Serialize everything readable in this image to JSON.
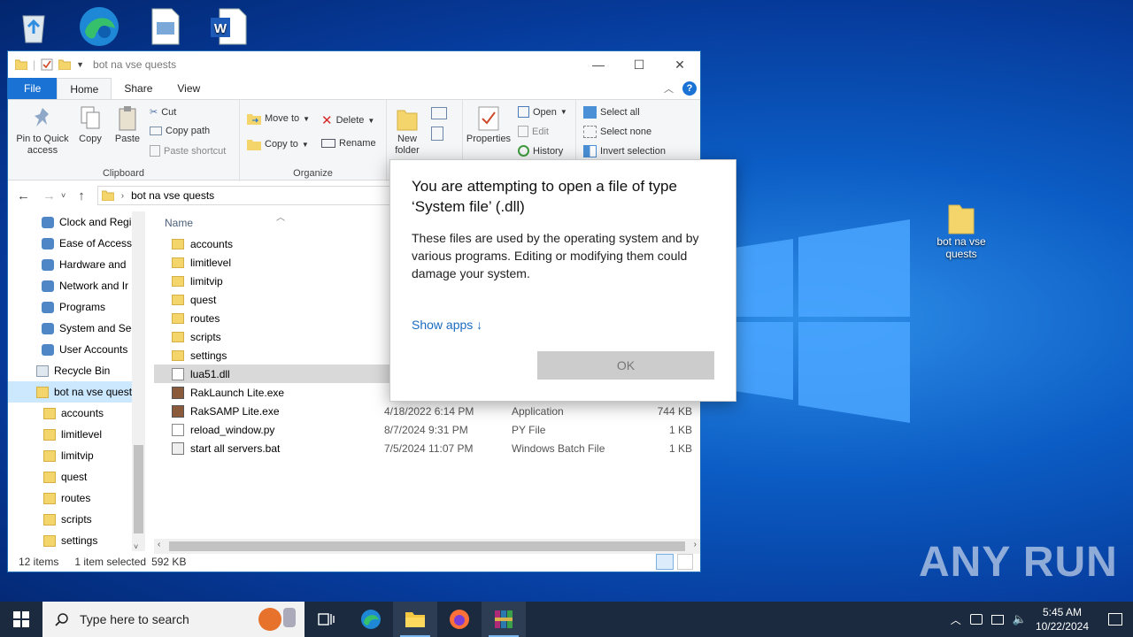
{
  "desktop": {
    "folder_label": "bot na vse quests"
  },
  "watermark": "ANY RUN",
  "explorer": {
    "title": "bot na vse quests",
    "tabs": [
      "File",
      "Home",
      "Share",
      "View"
    ],
    "ribbon": {
      "clipboard": {
        "label": "Clipboard",
        "pin": "Pin to Quick access",
        "copy": "Copy",
        "paste": "Paste",
        "cut": "Cut",
        "copy_path": "Copy path",
        "paste_shortcut": "Paste shortcut"
      },
      "organize": {
        "label": "Organize",
        "move_to": "Move to",
        "copy_to": "Copy to",
        "delete": "Delete",
        "rename": "Rename"
      },
      "new": {
        "new_folder": "New folder"
      },
      "open": {
        "properties": "Properties",
        "open": "Open",
        "edit": "Edit",
        "history": "History"
      },
      "select": {
        "select_all": "Select all",
        "select_none": "Select none",
        "invert": "Invert selection"
      }
    },
    "address": "bot na vse quests",
    "nav_items": [
      {
        "label": "Clock and Regi",
        "icon": "clock-icon"
      },
      {
        "label": "Ease of Access",
        "icon": "ease-of-access-icon"
      },
      {
        "label": "Hardware and",
        "icon": "hardware-icon"
      },
      {
        "label": "Network and Ir",
        "icon": "network-icon"
      },
      {
        "label": "Programs",
        "icon": "programs-icon"
      },
      {
        "label": "System and Sec",
        "icon": "shield-icon"
      },
      {
        "label": "User Accounts",
        "icon": "users-icon"
      },
      {
        "label": "Recycle Bin",
        "icon": "recycle-bin-icon"
      },
      {
        "label": "bot na vse quest",
        "icon": "folder-icon"
      },
      {
        "label": "accounts",
        "icon": "folder-icon"
      },
      {
        "label": "limitlevel",
        "icon": "folder-icon"
      },
      {
        "label": "limitvip",
        "icon": "folder-icon"
      },
      {
        "label": "quest",
        "icon": "folder-icon"
      },
      {
        "label": "routes",
        "icon": "folder-icon"
      },
      {
        "label": "scripts",
        "icon": "folder-icon"
      },
      {
        "label": "settings",
        "icon": "folder-icon"
      }
    ],
    "column_name": "Name",
    "files": [
      {
        "name": "accounts",
        "date": "",
        "type": "",
        "size": "",
        "icon": "folder-icon"
      },
      {
        "name": "limitlevel",
        "date": "",
        "type": "",
        "size": "",
        "icon": "folder-icon"
      },
      {
        "name": "limitvip",
        "date": "",
        "type": "",
        "size": "",
        "icon": "folder-icon"
      },
      {
        "name": "quest",
        "date": "",
        "type": "",
        "size": "",
        "icon": "folder-icon"
      },
      {
        "name": "routes",
        "date": "",
        "type": "",
        "size": "",
        "icon": "folder-icon"
      },
      {
        "name": "scripts",
        "date": "",
        "type": "",
        "size": "",
        "icon": "folder-icon"
      },
      {
        "name": "settings",
        "date": "",
        "type": "",
        "size": "",
        "icon": "folder-icon"
      },
      {
        "name": "lua51.dll",
        "date": "",
        "type": "",
        "size": "",
        "icon": "dll-file-icon"
      },
      {
        "name": "RakLaunch Lite.exe",
        "date": "",
        "type": "",
        "size": "",
        "icon": "exe-icon"
      },
      {
        "name": "RakSAMP Lite.exe",
        "date": "4/18/2022 6:14 PM",
        "type": "Application",
        "size": "744 KB",
        "icon": "exe-icon"
      },
      {
        "name": "reload_window.py",
        "date": "8/7/2024 9:31 PM",
        "type": "PY File",
        "size": "1 KB",
        "icon": "file-icon"
      },
      {
        "name": "start all servers.bat",
        "date": "7/5/2024 11:07 PM",
        "type": "Windows Batch File",
        "size": "1 KB",
        "icon": "bat-file-icon"
      }
    ],
    "status": {
      "items": "12 items",
      "selected": "1 item selected",
      "size": "592 KB"
    }
  },
  "dialog": {
    "heading": "You are attempting to open a file of type ‘System file’ (.dll)",
    "body": "These files are used by the operating system and by various programs. Editing or modifying them could damage your system.",
    "show_apps": "Show apps ↓",
    "ok": "OK"
  },
  "taskbar": {
    "search_placeholder": "Type here to search",
    "time": "5:45 AM",
    "date": "10/22/2024"
  }
}
